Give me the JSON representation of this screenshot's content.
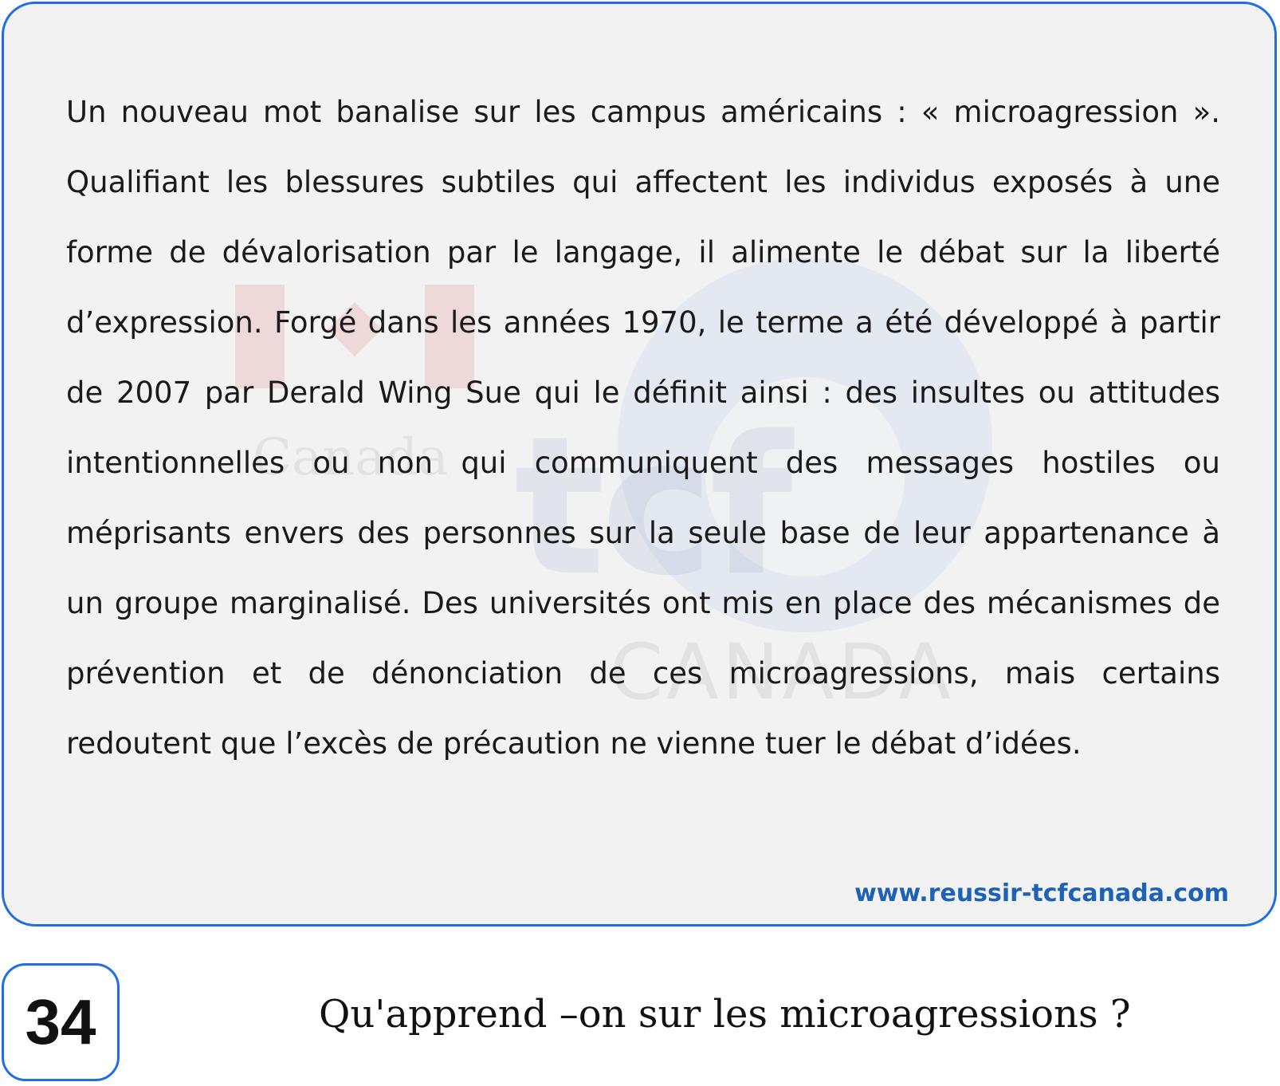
{
  "passage": {
    "text": "Un nouveau mot banalise sur les campus américains : « microagression ». Qualifiant les blessures subtiles qui affectent les individus exposés à une forme de dévalorisation par le langage, il alimente le débat sur la liberté d’expression. Forgé dans les années 1970, le terme a été développé à partir de 2007 par Derald Wing Sue qui le définit ainsi : des insultes ou attitudes intentionnelles ou non qui communiquent des messages hostiles ou méprisants envers des personnes sur la seule base de leur appartenance à un groupe marginalisé. Des universités ont mis en place des mécanismes de prévention et de dénonciation de ces microagressions, mais certains redoutent que l’excès de précaution ne vienne tuer le débat d’idées.",
    "website": "www.reussir-tcfcanada.com"
  },
  "question": {
    "number": "34",
    "text": "Qu'apprend –on sur les microagressions ?"
  },
  "watermark": {
    "logo_text": "tcf",
    "brand_text": "CANADA",
    "flag_caption": "Canada",
    "icon": "canada-flag-icon",
    "colors": {
      "flag": "#d62828",
      "globe": "#3a6fd0"
    }
  },
  "colors": {
    "border": "#1f6fe0",
    "card_background": "#f2f2f3",
    "url": "#1e62b8",
    "text": "#1a1a1a"
  }
}
